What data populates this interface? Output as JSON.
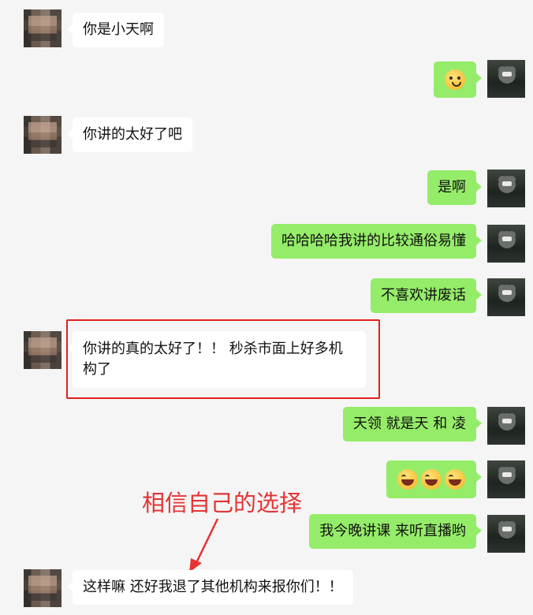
{
  "messages": [
    {
      "side": "left",
      "text": "你是小天啊"
    },
    {
      "side": "right",
      "emoji": [
        "blush-emoji"
      ]
    },
    {
      "side": "left",
      "text": "你讲的太好了吧"
    },
    {
      "side": "right",
      "text": "是啊"
    },
    {
      "side": "right",
      "text": "哈哈哈哈我讲的比较通俗易懂"
    },
    {
      "side": "right",
      "text": "不喜欢讲废话"
    },
    {
      "side": "left",
      "text_line1": "你讲的真的太好了！！ 秒杀市面上好多机",
      "text_line2": "构了"
    },
    {
      "side": "right",
      "text": "天领 就是天 和 凌"
    },
    {
      "side": "right",
      "emoji": [
        "laugh-cry-emoji",
        "laugh-cry-emoji",
        "laugh-cry-emoji"
      ]
    },
    {
      "side": "right",
      "text": "我今晚讲课 来听直播哟"
    },
    {
      "side": "left",
      "text": "这样嘛 还好我退了其他机构来报你们！！"
    }
  ],
  "annotation": {
    "text": "相信自己的选择",
    "color": "#e53333"
  },
  "colors": {
    "background": "#f5f5f5",
    "incoming": "#ffffff",
    "outgoing": "#95ec69",
    "highlight": "#e02020"
  }
}
